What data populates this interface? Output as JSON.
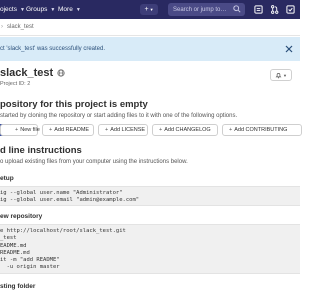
{
  "navbar": {
    "projects": "ojects",
    "groups": "Groups",
    "more": "More",
    "search_placeholder": "Search or jump to…"
  },
  "breadcrumb": {
    "item": "slack_test"
  },
  "flash": {
    "message": "ct 'slack_test' was successfully created."
  },
  "project": {
    "name": "slack_test",
    "id_label": "Project ID: 2"
  },
  "empty": {
    "title": "pository for this project is empty",
    "subtitle": "started by cloning the repository or start adding files to it with one of the following options."
  },
  "buttons": {
    "new_file": "New file",
    "add_readme": "Add README",
    "add_license": "Add LICENSE",
    "add_changelog": "Add CHANGELOG",
    "add_contributing": "Add CONTRIBUTING"
  },
  "cli": {
    "title": "d line instructions",
    "subtitle": "o upload existing files from your computer using the instructions below."
  },
  "setup": {
    "heading": "etup",
    "lines": [
      "ig --global user.name \"Administrator\"",
      "ig --global user.email \"admin@example.com\""
    ]
  },
  "new_repo": {
    "heading": "ew repository",
    "lines": [
      "e http://localhost/root/slack_test.git",
      "_test",
      "EADME.md",
      "README.md",
      "it -m \"add README\"",
      "  -u origin master"
    ]
  },
  "existing": {
    "heading": "sting folder"
  },
  "colors": {
    "navbar": "#292961",
    "flash_bg": "#d8ebf8",
    "code_bg": "#f0f0f0"
  }
}
